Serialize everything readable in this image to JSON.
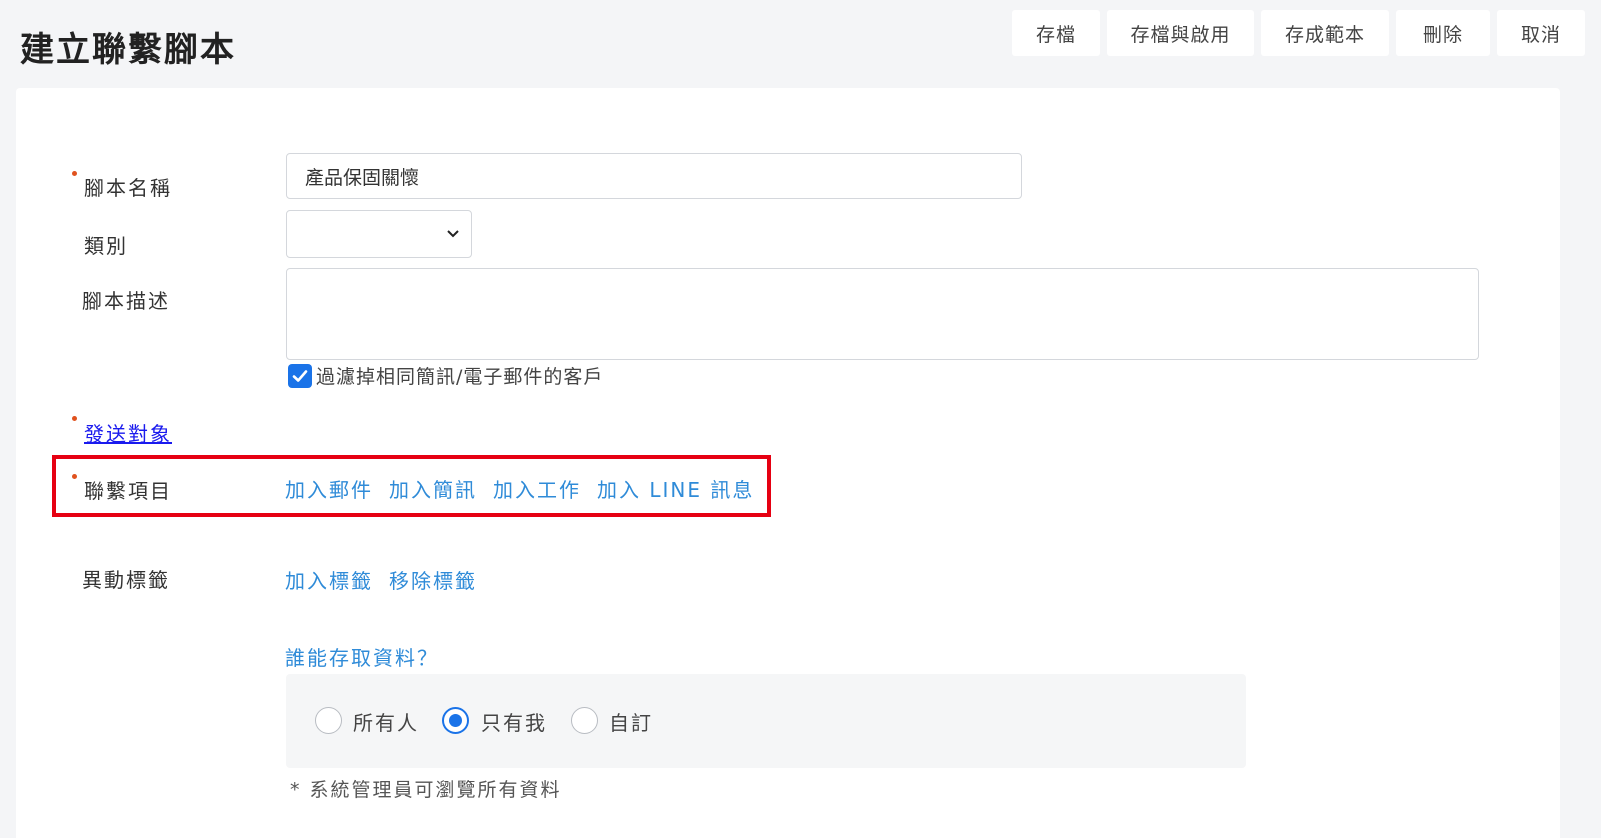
{
  "page": {
    "title": "建立聯繫腳本"
  },
  "toolbar": {
    "save": "存檔",
    "save_enable": "存檔與啟用",
    "save_template": "存成範本",
    "delete": "刪除",
    "cancel": "取消"
  },
  "form": {
    "name_label": "腳本名稱",
    "name_value": "產品保固關懷",
    "category_label": "類別",
    "category_value": "",
    "description_label": "腳本描述",
    "description_value": "",
    "filter_checkbox_label": "過濾掉相同簡訊/電子郵件的客戶",
    "filter_checked": true,
    "send_target_link": "發送對象",
    "contact_items_label": "聯繫項目",
    "contact_actions": [
      "加入郵件",
      "加入簡訊",
      "加入工作",
      "加入 LINE 訊息"
    ],
    "tag_label": "異動標籤",
    "tag_actions": [
      "加入標籤",
      "移除標籤"
    ],
    "access_question": "誰能存取資料？",
    "access_options": [
      "所有人",
      "只有我",
      "自訂"
    ],
    "access_selected": "只有我",
    "admin_note": "*  系統管理員可瀏覽所有資料"
  },
  "colors": {
    "accent": "#1a73e8",
    "link": "#2f8bd8",
    "required_dot": "#e0521e",
    "highlight": "#e60012"
  }
}
